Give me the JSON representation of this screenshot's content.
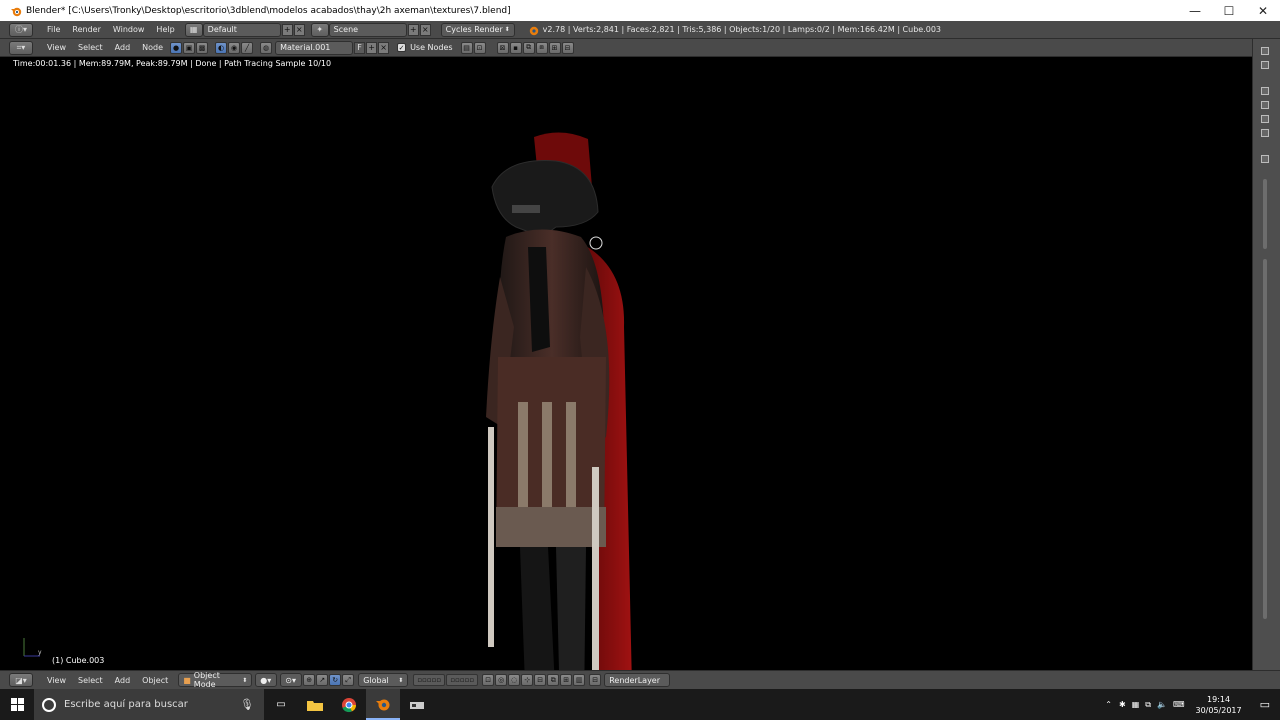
{
  "window": {
    "title": "Blender* [C:\\Users\\Tronky\\Desktop\\escritorio\\3dblend\\modelos acabados\\thay\\2h axeman\\textures\\7.blend]",
    "minimize": "—",
    "maximize": "☐",
    "close": "✕"
  },
  "info_header": {
    "menus": [
      "File",
      "Render",
      "Window",
      "Help"
    ],
    "layout": "Default",
    "scene": "Scene",
    "engine": "Cycles Render",
    "stats": "v2.78 | Verts:2,841 | Faces:2,821 | Tris:5,386 | Objects:1/20 | Lamps:0/2 | Mem:166.42M | Cube.003"
  },
  "node_header": {
    "menus": [
      "View",
      "Select",
      "Add",
      "Node"
    ],
    "material": "Material.001",
    "fake_user": "F",
    "use_nodes_label": "Use Nodes",
    "use_nodes_checked": true
  },
  "viewport": {
    "render_status": "Time:00:01.36 | Mem:89.79M, Peak:89.79M | Done | Path Tracing Sample 10/10",
    "object_label": "(1) Cube.003",
    "axis_y": "y"
  },
  "view3d_header": {
    "menus": [
      "View",
      "Select",
      "Add",
      "Object"
    ],
    "mode": "Object Mode",
    "orientation": "Global",
    "render_layer": "RenderLayer"
  },
  "taskbar": {
    "search_placeholder": "Escribe aquí para buscar",
    "time": "19:14",
    "date": "30/05/2017"
  },
  "colors": {
    "blender_bg": "#4a4a4a",
    "accent_blue": "#5680c2",
    "cape_red": "#8c1010"
  }
}
